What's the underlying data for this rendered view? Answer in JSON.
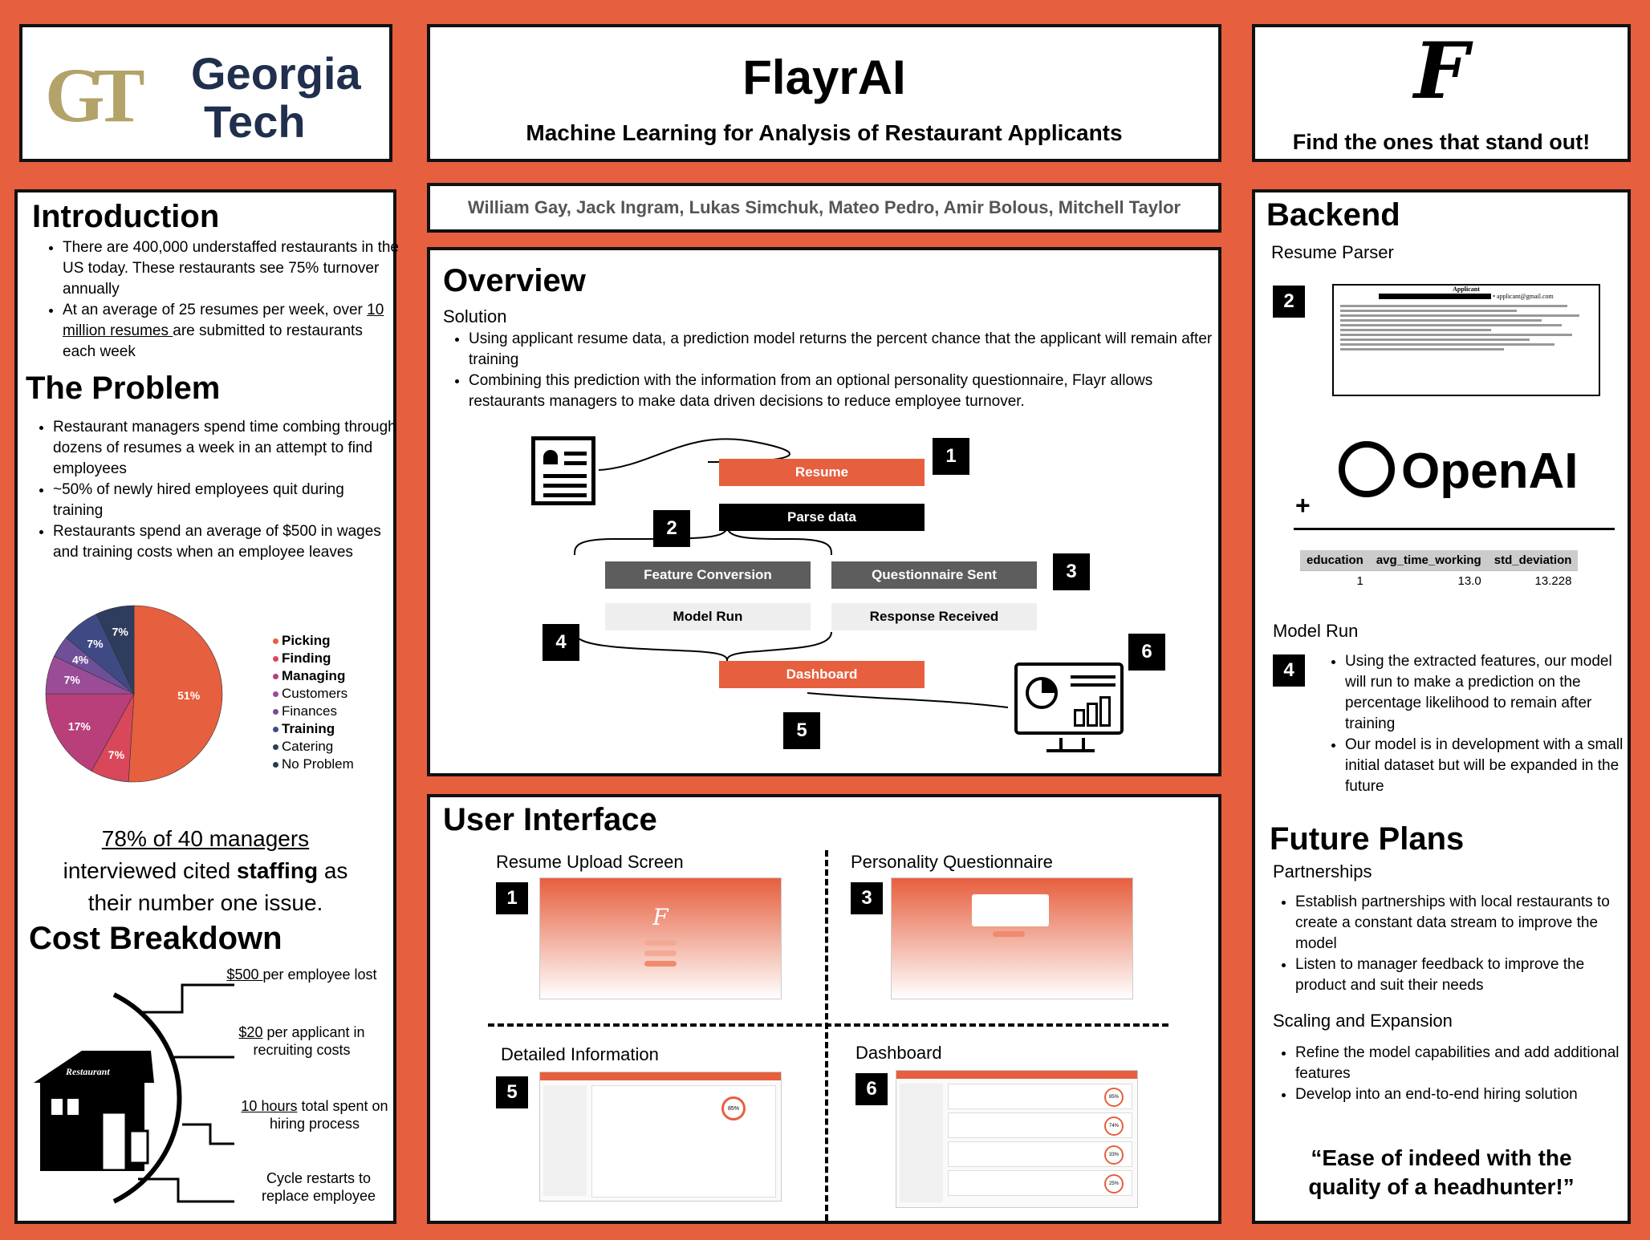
{
  "logo": {
    "gt_text": "GT",
    "name_line1": "Georgia",
    "name_line2": "Tech"
  },
  "header": {
    "title": "FlayrAI",
    "subtitle": "Machine Learning for Analysis of Restaurant Applicants"
  },
  "brand": {
    "mark": "F",
    "tagline": "Find the ones that stand out!"
  },
  "authors": "William Gay, Jack Ingram, Lukas Simchuk, Mateo Pedro, Amir Bolous, Mitchell Taylor",
  "intro": {
    "title": "Introduction",
    "b1": "There are 400,000 understaffed restaurants in the US today. These restaurants see 75% turnover annually",
    "b2_pre": "At an average of 25 resumes per week, over ",
    "b2_link": "10 million resumes ",
    "b2_post": "are submitted to restaurants each week"
  },
  "problem": {
    "title": "The Problem",
    "b1": "Restaurant managers spend time combing through dozens of resumes a week in an attempt to find employees",
    "b2": "~50% of newly hired employees quit during training",
    "b3": "Restaurants spend an average of $500 in wages and training costs when an employee leaves"
  },
  "chart_data": {
    "type": "pie",
    "slices": [
      {
        "label": "Picking",
        "value": 51,
        "color": "#e65f3e"
      },
      {
        "label": "Finding",
        "value": 7,
        "color": "#d9485a"
      },
      {
        "label": "Managing",
        "value": 17,
        "color": "#b83f7a"
      },
      {
        "label": "Customers",
        "value": 7,
        "color": "#9a4c96"
      },
      {
        "label": "Finances",
        "value": 4,
        "color": "#6e4f98"
      },
      {
        "label": "Training",
        "value": 7,
        "color": "#3f4a85"
      },
      {
        "label": "Catering",
        "value": 7,
        "color": "#2e3d5e"
      },
      {
        "label": "No Problem",
        "value": 0,
        "color": "#2a3a52"
      }
    ],
    "bold_labels": [
      "Picking",
      "Finding",
      "Managing",
      "Training"
    ],
    "legend": "right"
  },
  "stat": {
    "underlined": "78% of 40 managers",
    "mid_pre": "interviewed cited ",
    "mid_bold": "staffing",
    "mid_post": " as",
    "end": "their number one issue."
  },
  "cost": {
    "title": "Cost Breakdown",
    "restaurant_sign": "Restaurant",
    "c1_u": "$500 ",
    "c1": "per employee lost",
    "c2_u": "$20",
    "c2": " per applicant in recruiting costs",
    "c3_u": "10 hours",
    "c3": " total spent on hiring process",
    "c4": "Cycle restarts to replace employee"
  },
  "overview": {
    "title": "Overview",
    "solution": "Solution",
    "b1": "Using applicant resume data, a prediction model returns the percent chance that the applicant will remain after training",
    "b2": "Combining this prediction with the information from an optional personality questionnaire, Flayr allows restaurants managers to make data driven decisions to reduce employee turnover.",
    "flow": {
      "resume": "Resume",
      "parse": "Parse data",
      "feature": "Feature Conversion",
      "questionnaire": "Questionnaire Sent",
      "model": "Model Run",
      "response": "Response Received",
      "dashboard": "Dashboard",
      "n1": "1",
      "n2": "2",
      "n3": "3",
      "n4": "4",
      "n5": "5",
      "n6": "6"
    }
  },
  "ui": {
    "title": "User Interface",
    "s1": "Resume Upload Screen",
    "s3": "Personality Questionnaire",
    "s5": "Detailed Information",
    "s6": "Dashboard",
    "n1": "1",
    "n3": "3",
    "n5": "5",
    "n6": "6",
    "pct1": "85%",
    "pct2": "74%",
    "pct3": "33%",
    "pct4": "25%"
  },
  "backend": {
    "title": "Backend",
    "parser": "Resume Parser",
    "n2": "2",
    "n4": "4",
    "resume_head": "Applicant",
    "resume_email": "• applicant@gmail.com",
    "openai": "OpenAI",
    "plus": "+",
    "table": {
      "headers": [
        "education",
        "avg_time_working",
        "std_deviation"
      ],
      "row": [
        "1",
        "13.0",
        "13.228"
      ]
    },
    "model_run": "Model Run",
    "m1": "Using the extracted features, our model will run to make a prediction on the percentage likelihood to remain after training",
    "m2": "Our model is in development with a small initial dataset but will be expanded in the future"
  },
  "future": {
    "title": "Future Plans",
    "partnerships": "Partnerships",
    "p1": "Establish partnerships with local restaurants to create a constant data stream to improve the model",
    "p2": "Listen to manager feedback to improve the product and suit their needs",
    "scaling": "Scaling and Expansion",
    "s1": "Refine the model capabilities and add additional features",
    "s2": "Develop into an end-to-end hiring solution",
    "quote": "“Ease of indeed with the quality of a headhunter!”"
  }
}
